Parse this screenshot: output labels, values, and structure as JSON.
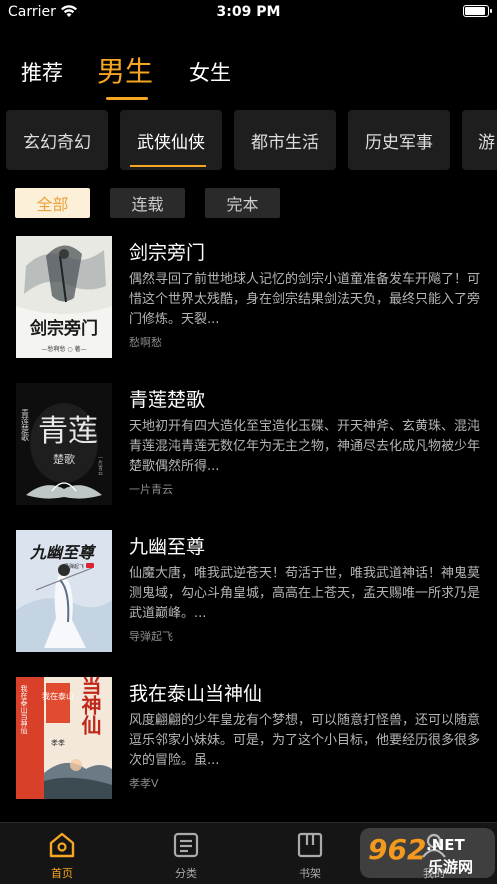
{
  "status_bar": {
    "carrier": "Carrier",
    "time": "3:09 PM",
    "battery_level": 1.0
  },
  "top_tabs": [
    {
      "label": "推荐",
      "active": false
    },
    {
      "label": "男生",
      "active": true
    },
    {
      "label": "女生",
      "active": false
    }
  ],
  "genres": [
    {
      "label": "玄幻奇幻",
      "active": false
    },
    {
      "label": "武侠仙侠",
      "active": true
    },
    {
      "label": "都市生活",
      "active": false
    },
    {
      "label": "历史军事",
      "active": false
    },
    {
      "label": "游",
      "active": false
    }
  ],
  "filters": [
    {
      "label": "全部",
      "active": true
    },
    {
      "label": "连载",
      "active": false
    },
    {
      "label": "完本",
      "active": false
    }
  ],
  "books": [
    {
      "title": "剑宗旁门",
      "description": "偶然寻回了前世地球人记忆的剑宗小道童准备发车开飚了！可惜这个世界太残酷，身在剑宗结果剑法天负，最终只能入了旁门修炼。天裂...",
      "author": "愁啊愁",
      "cover": {
        "title": "剑宗旁门",
        "author": "—愁啊愁 ○ 著—",
        "bg": "#e9e9e4",
        "accent": "#1a1a1a"
      }
    },
    {
      "title": "青莲楚歌",
      "description": "天地初开有四大造化至宝造化玉碟、开天神斧、玄黄珠、混沌青莲混沌青莲无数亿年为无主之物，神通尽去化成凡物被少年楚歌偶然所得...",
      "author": "一片青云",
      "cover": {
        "title": "青莲",
        "subtitle": "楚歌",
        "side_text": "青莲楚歌",
        "author": "一片青云",
        "bg": "#0e0e0e",
        "accent": "#e8e8e8"
      }
    },
    {
      "title": "九幽至尊",
      "description": "仙魔大唐，唯我武逆苍天！苟活于世，唯我武道神话！神鬼莫测鬼域，勾心斗角皇城，高高在上苍天，孟天赐唯一所求乃是武道巅峰。...",
      "author": "导弹起飞",
      "cover": {
        "title": "九幽至尊",
        "author": "导弹起飞",
        "bg": "#dbe4ee",
        "accent": "#1a1a1a"
      }
    },
    {
      "title": "我在泰山当神仙",
      "description": "风度翩翩的少年皇龙有个梦想，可以随意打怪兽，还可以随意逗乐邻家小妹妹。可是，为了这个小目标，他要经历很多很多次的冒险。虽...",
      "author": "孝孝V",
      "cover": {
        "title": "当神仙",
        "subtitle": "我在泰山",
        "side_text": "我在泰山当神仙",
        "author": "孝孝",
        "bg": "#f3e8da",
        "accent": "#d8402a"
      }
    }
  ],
  "tabbar": [
    {
      "label": "首页",
      "icon": "home-icon",
      "active": true
    },
    {
      "label": "分类",
      "icon": "category-icon",
      "active": false
    },
    {
      "label": "书架",
      "icon": "bookshelf-icon",
      "active": false
    },
    {
      "label": "我的",
      "icon": "profile-icon",
      "active": false
    }
  ],
  "watermark": {
    "brand": "962",
    "suffix": ".NET",
    "site": "乐游网"
  },
  "colors": {
    "accent": "#f5a623",
    "background": "#000000",
    "chip": "#1e1e1e"
  }
}
